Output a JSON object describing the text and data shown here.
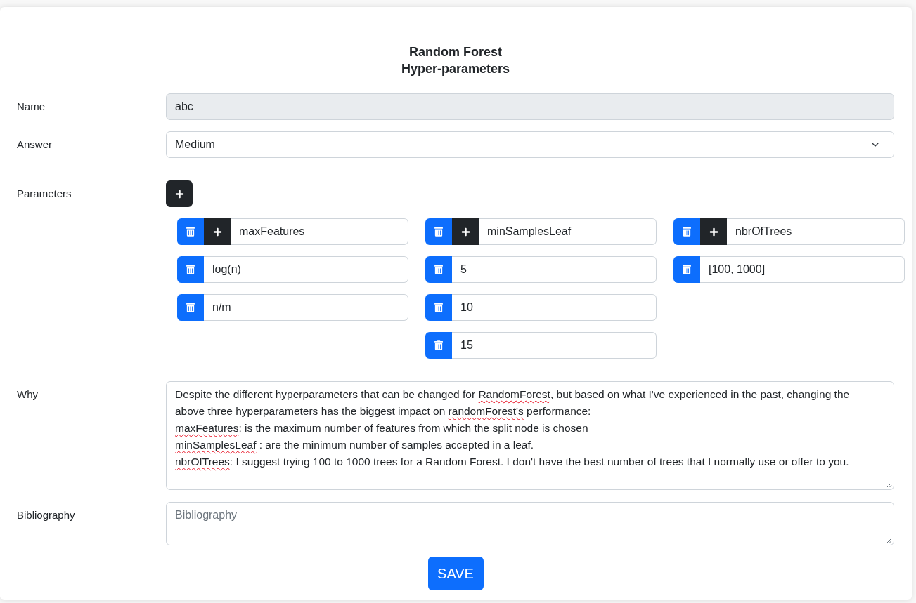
{
  "form": {
    "title": [
      "Random Forest",
      "Hyper-parameters"
    ],
    "fields": [
      {
        "kind": "text",
        "label": "Name",
        "value": "abc",
        "disabled": true
      },
      {
        "kind": "select",
        "label": "Answer",
        "value": "Medium"
      },
      {
        "kind": "parameters",
        "label": "Parameters",
        "groups": [
          {
            "name": "maxFeatures",
            "values": [
              "log(n)",
              "n/m"
            ]
          },
          {
            "name": "minSamplesLeaf",
            "values": [
              "5",
              "10",
              "15"
            ]
          },
          {
            "name": "nbrOfTrees",
            "values": [
              "[100, 1000]"
            ]
          }
        ]
      },
      {
        "kind": "textarea",
        "label": "Why",
        "lines": [
          [
            {
              "text": "Despite the different hyperparameters that can be changed for ",
              "flagged": false
            },
            {
              "text": "RandomForest",
              "flagged": true
            },
            {
              "text": ", but based on what I've experienced in the past, changing the",
              "flagged": false
            }
          ],
          [
            {
              "text": "above three hyperparameters has the biggest impact on ",
              "flagged": false
            },
            {
              "text": "randomForest's",
              "flagged": true
            },
            {
              "text": " performance:",
              "flagged": false
            }
          ],
          [
            {
              "text": "maxFeatures",
              "flagged": true
            },
            {
              "text": ": is the maximum number of features from which the split node is chosen",
              "flagged": false
            }
          ],
          [
            {
              "text": "minSamplesLeaf",
              "flagged": true
            },
            {
              "text": " : are the minimum number of samples accepted in a leaf.",
              "flagged": false
            }
          ],
          [
            {
              "text": "nbrOfTrees",
              "flagged": true
            },
            {
              "text": ": I suggest trying 100 to 1000 trees for a Random Forest. I don't have the best number of trees that I normally use or offer to you.",
              "flagged": false
            }
          ]
        ]
      },
      {
        "kind": "textarea",
        "label": "Bibliography",
        "placeholder": "Bibliography"
      }
    ],
    "save_button": "SAVE"
  }
}
